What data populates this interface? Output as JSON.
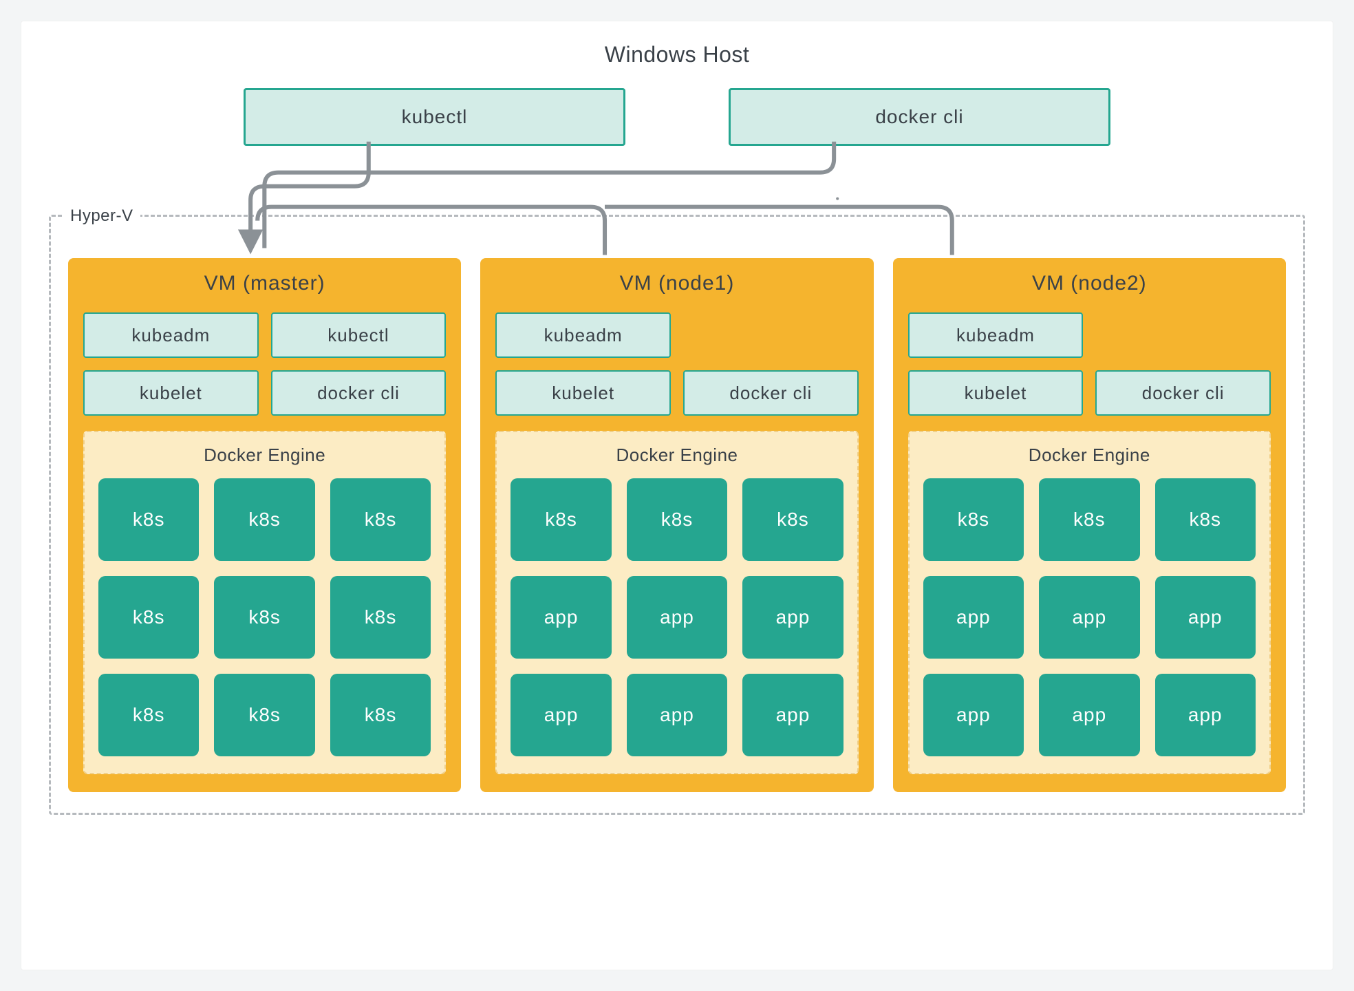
{
  "host": {
    "title": "Windows Host",
    "cli": {
      "kubectl": "kubectl",
      "docker": "docker cli"
    }
  },
  "hyperv": {
    "label": "Hyper-V",
    "vms": [
      {
        "title": "VM (master)",
        "tools": [
          "kubeadm",
          "kubectl",
          "kubelet",
          "docker cli"
        ],
        "engine_label": "Docker Engine",
        "containers": [
          "k8s",
          "k8s",
          "k8s",
          "k8s",
          "k8s",
          "k8s",
          "k8s",
          "k8s",
          "k8s"
        ]
      },
      {
        "title": "VM (node1)",
        "tools": [
          "kubeadm",
          "",
          "kubelet",
          "docker cli"
        ],
        "engine_label": "Docker Engine",
        "containers": [
          "k8s",
          "k8s",
          "k8s",
          "app",
          "app",
          "app",
          "app",
          "app",
          "app"
        ]
      },
      {
        "title": "VM (node2)",
        "tools": [
          "kubeadm",
          "",
          "kubelet",
          "docker cli"
        ],
        "engine_label": "Docker Engine",
        "containers": [
          "k8s",
          "k8s",
          "k8s",
          "app",
          "app",
          "app",
          "app",
          "app",
          "app"
        ]
      }
    ]
  },
  "colors": {
    "background": "#f3f5f6",
    "host_bg": "#ffffff",
    "cli_bg": "#d3ece7",
    "cli_border": "#25a690",
    "hyperv_border": "#b5b9bd",
    "vm_bg": "#f5b42e",
    "engine_bg": "#fcecc4",
    "container_bg": "#25a690",
    "arrow": "#8b9196",
    "text": "#3a4148"
  }
}
